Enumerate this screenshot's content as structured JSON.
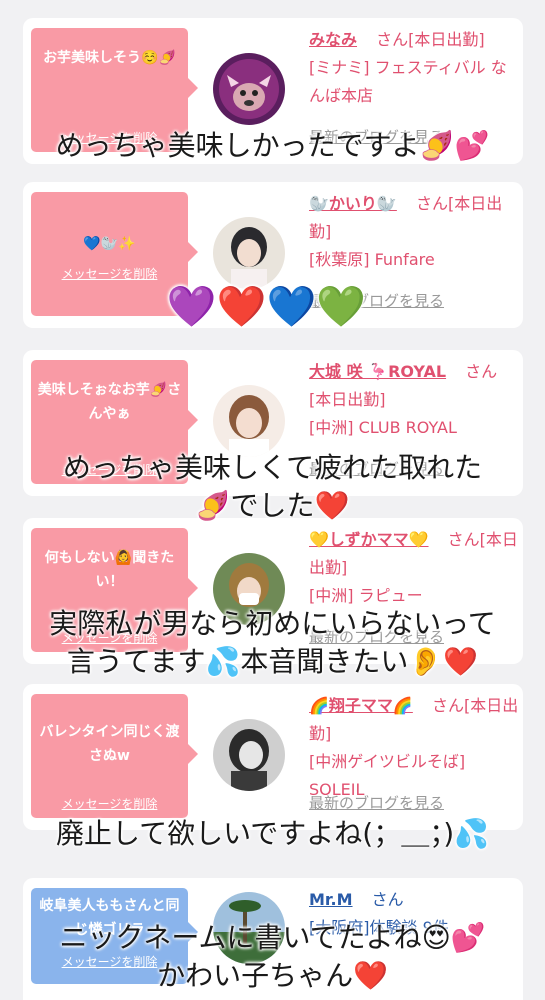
{
  "cards": [
    {
      "message": "お芋美味しそう☺️🍠",
      "delete_label": "メッセージを削除",
      "name": "みなみ",
      "suffix": "さん[本日出勤]",
      "shop": "[ミナミ] フェスティバル なんば本店",
      "blog": "最新のブログを見る"
    },
    {
      "message": "💙🦭✨",
      "delete_label": "メッセージを削除",
      "name": "🦭かいり🦭",
      "suffix": "さん[本日出勤]",
      "shop": "[秋葉原] Funfare",
      "blog": "最新のブログを見る"
    },
    {
      "message": "美味しそぉなお芋🍠さんやぁ",
      "delete_label": "メッセージを削除",
      "name": "大城 咲 🦩ROYAL",
      "suffix": "さん[本日出勤]",
      "shop": "[中洲] CLUB ROYAL",
      "blog": "最新のブログを見る"
    },
    {
      "message": "何もしない🙆聞きたい！",
      "delete_label": "メッセージを削除",
      "name": "💛しずかママ💛",
      "suffix": "さん[本日出勤]",
      "shop": "[中洲] ラピュー",
      "blog": "最新のブログを見る"
    },
    {
      "message": "バレンタイン同じく渡さぬw",
      "delete_label": "メッセージを削除",
      "name": "🌈翔子ママ🌈",
      "suffix": "さん[本日出勤]",
      "shop": "[中洲ゲイツビルそば] SOLEIL",
      "blog": "最新のブログを見る"
    },
    {
      "message": "岐阜美人ももさんと同じ憐ゴリラ",
      "delete_label": "メッセージを削除",
      "name": "Mr.M",
      "suffix": "さん",
      "shop": "[大阪府]体験談 9件",
      "blog": ""
    }
  ],
  "overlays": {
    "o1": "めっちゃ美味しかったですよ🍠💕",
    "o2": "💜❤️💙💚",
    "o3a": "めっちゃ美味しくて疲れた取れた",
    "o3b": "🍠でした❤️",
    "o4a": "実際私が男なら初めにいらないって",
    "o4b": "言うてます💦本音聞きたい👂❤️",
    "o5": "廃止して欲しいですよね(；＿；)💦",
    "o6a": "ニックネームに書いてたよね😍💕",
    "o6b": "かわい子ちゃん❤️"
  },
  "colors": {
    "bubble": "#f99aa5",
    "bubble_blue": "#8ab4ec",
    "name_pink": "#e0506f",
    "name_blue": "#2a5ba8",
    "background": "#f1f1f3"
  }
}
